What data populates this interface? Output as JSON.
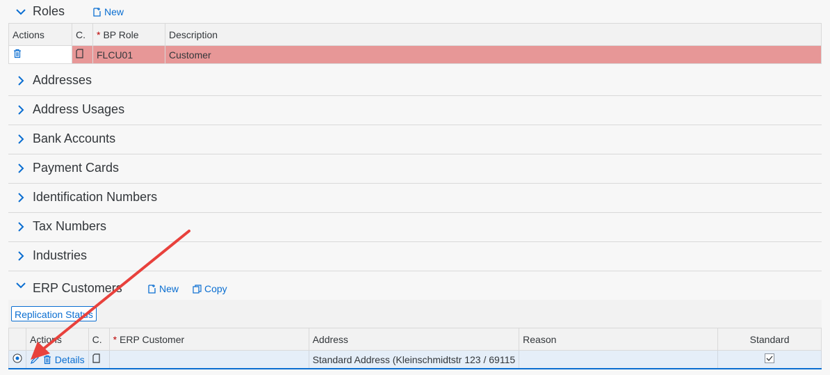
{
  "roles": {
    "title": "Roles",
    "new_label": "New",
    "headers": [
      "Actions",
      "C.",
      "BP Role",
      "Description"
    ],
    "row": {
      "bp_role": "FLCU01",
      "description": "Customer"
    }
  },
  "sections": [
    "Addresses",
    "Address Usages",
    "Bank Accounts",
    "Payment Cards",
    "Identification Numbers",
    "Tax Numbers",
    "Industries"
  ],
  "erp": {
    "title": "ERP Customers",
    "new_label": "New",
    "copy_label": "Copy",
    "replication_label": "Replication Status",
    "headers": [
      "Actions",
      "C.",
      "ERP Customer",
      "Address",
      "Reason",
      "Standard"
    ],
    "row": {
      "details_label": "Details",
      "erp_customer": "",
      "address": "Standard Address (Kleinschmidtstr 123 / 69115",
      "reason": "",
      "standard_checked": true
    }
  },
  "colors": {
    "accent": "#0a6ed1",
    "error_row": "#e79797",
    "selected_row": "#e5eef8",
    "arrow": "#e8413c"
  }
}
